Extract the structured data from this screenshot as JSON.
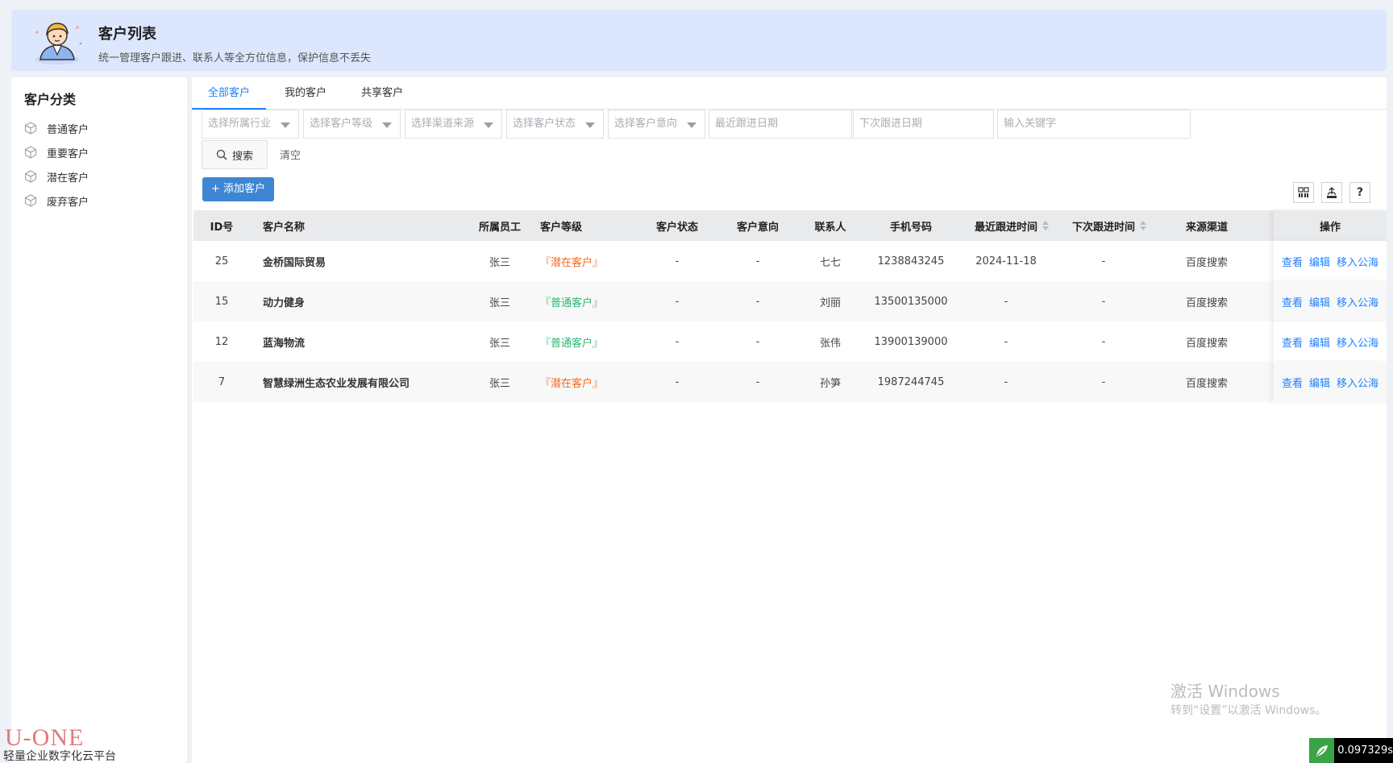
{
  "header": {
    "title": "客户列表",
    "subtitle": "统一管理客户跟进、联系人等全方位信息，保护信息不丢失"
  },
  "sidebar": {
    "title": "客户分类",
    "items": [
      {
        "label": "普通客户",
        "icon": "cube-icon"
      },
      {
        "label": "重要客户",
        "icon": "cube-icon"
      },
      {
        "label": "潜在客户",
        "icon": "cube-icon"
      },
      {
        "label": "废弃客户",
        "icon": "cube-icon"
      }
    ]
  },
  "tabs": [
    {
      "label": "全部客户",
      "active": true
    },
    {
      "label": "我的客户",
      "active": false
    },
    {
      "label": "共享客户",
      "active": false
    }
  ],
  "filters": {
    "industry": "选择所属行业",
    "level": "选择客户等级",
    "channel": "选择渠道来源",
    "status": "选择客户状态",
    "intent": "选择客户意向",
    "recent_date": "最近跟进日期",
    "next_date": "下次跟进日期",
    "keyword": "输入关键字"
  },
  "actions": {
    "search": "搜索",
    "clear": "清空",
    "add": "+ 添加客户",
    "help": "?"
  },
  "table": {
    "columns": {
      "id": "ID号",
      "name": "客户名称",
      "employee": "所属员工",
      "level": "客户等级",
      "status": "客户状态",
      "intent": "客户意向",
      "contact": "联系人",
      "phone": "手机号码",
      "recent": "最近跟进时间",
      "next": "下次跟进时间",
      "channel": "来源渠道",
      "ops": "操作"
    },
    "rows": [
      {
        "id": "25",
        "name": "金桥国际贸易",
        "employee": "张三",
        "level": "『潜在客户』",
        "level_color": "#f06a1f",
        "status": "-",
        "intent": "-",
        "contact": "七七",
        "phone": "1238843245",
        "recent": "2024-11-18",
        "next": "-",
        "channel": "百度搜索"
      },
      {
        "id": "15",
        "name": "动力健身",
        "employee": "张三",
        "level": "『普通客户』",
        "level_color": "#2bb673",
        "status": "-",
        "intent": "-",
        "contact": "刘丽",
        "phone": "13500135000",
        "recent": "-",
        "next": "-",
        "channel": "百度搜索"
      },
      {
        "id": "12",
        "name": "蓝海物流",
        "employee": "张三",
        "level": "『普通客户』",
        "level_color": "#2bb673",
        "status": "-",
        "intent": "-",
        "contact": "张伟",
        "phone": "13900139000",
        "recent": "-",
        "next": "-",
        "channel": "百度搜索"
      },
      {
        "id": "7",
        "name": "智慧绿洲生态农业发展有限公司",
        "employee": "张三",
        "level": "『潜在客户』",
        "level_color": "#f06a1f",
        "status": "-",
        "intent": "-",
        "contact": "孙笋",
        "phone": "1987244745",
        "recent": "-",
        "next": "-",
        "channel": "百度搜索"
      }
    ],
    "row_actions": {
      "view": "查看",
      "edit": "编辑",
      "move": "移入公海"
    }
  },
  "footer": {
    "logo_text": "U-ONE",
    "platform": "轻量企业数字化云平台",
    "watermark_title": "激活 Windows",
    "watermark_sub": "转到“设置”以激活 Windows。",
    "timer": "0.097329s"
  },
  "colors": {
    "accent": "#1e80ff",
    "add_button": "#3e86d4",
    "banner_bg": "#dce7fd"
  }
}
